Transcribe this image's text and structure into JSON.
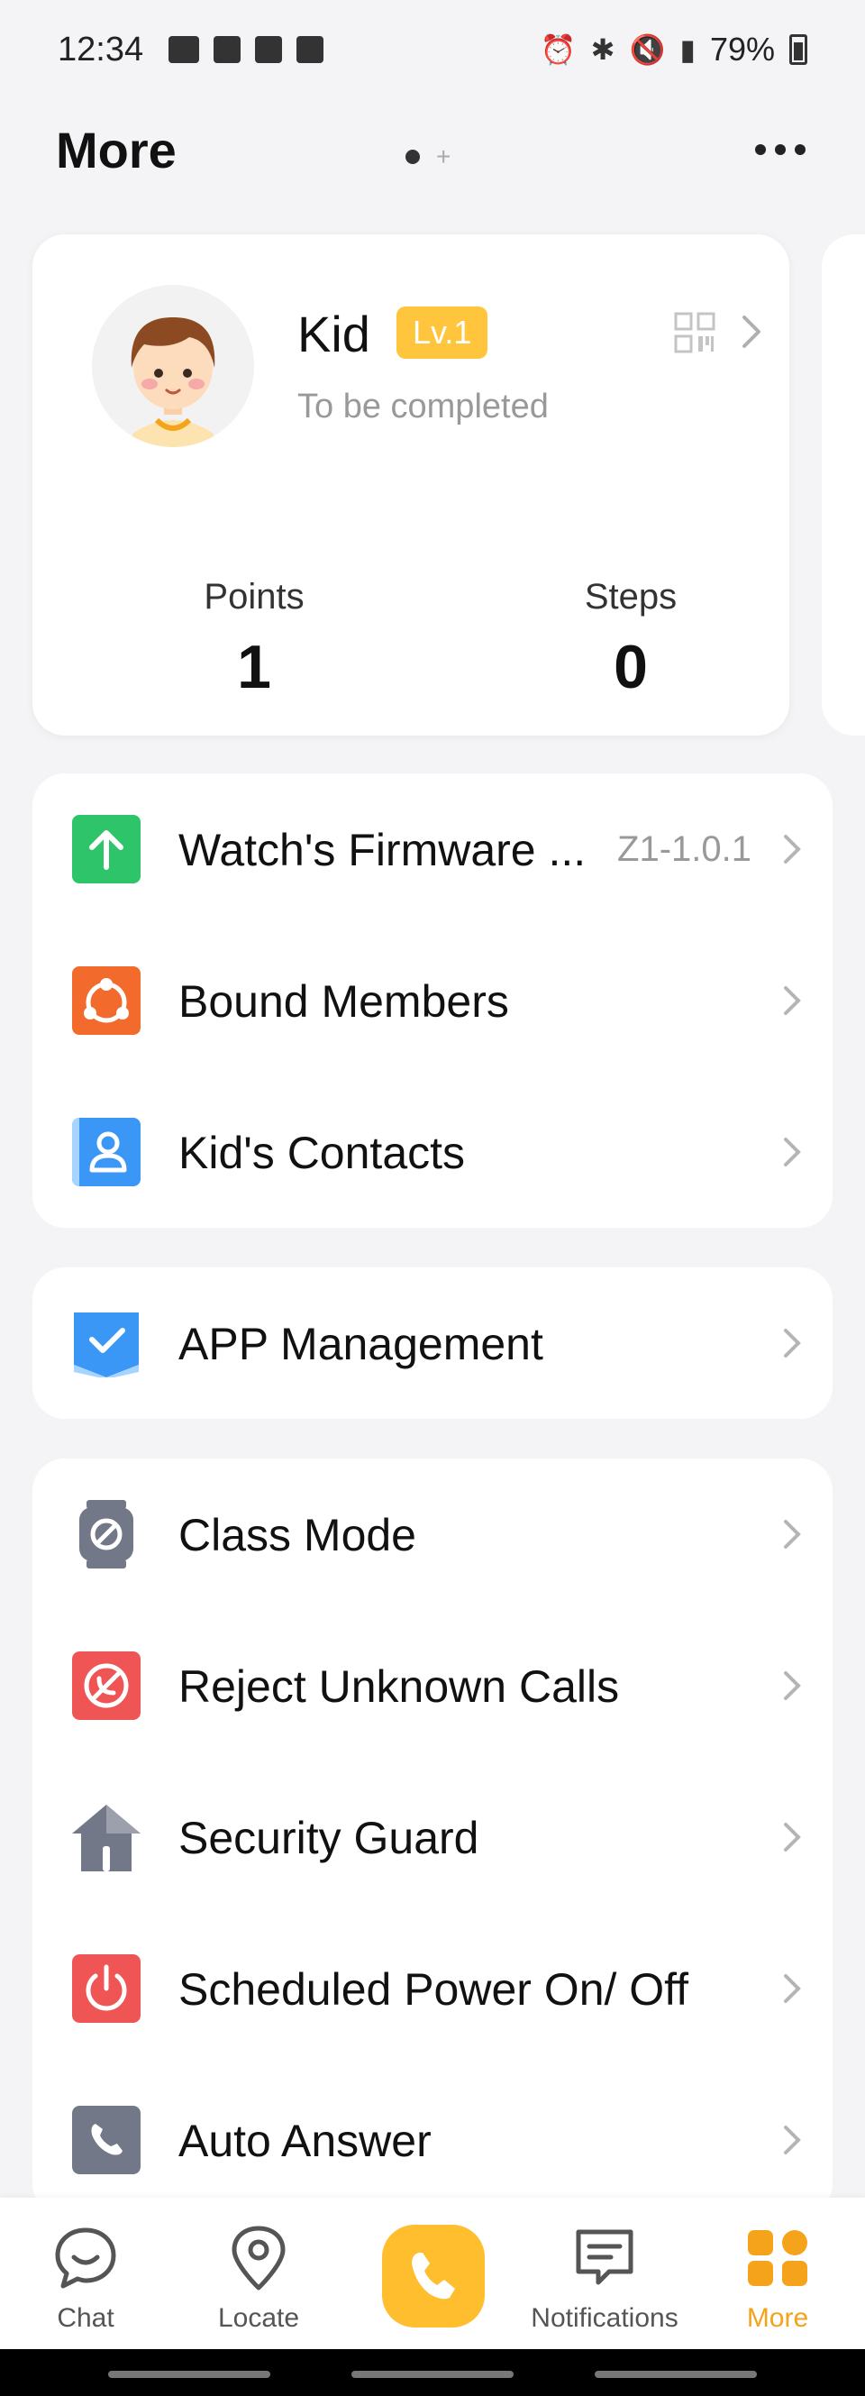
{
  "status_bar": {
    "time": "12:34",
    "battery": "79%"
  },
  "header": {
    "title": "More"
  },
  "profile": {
    "name": "Kid",
    "level": "Lv.1",
    "subtitle": "To be completed",
    "points_label": "Points",
    "points_value": "1",
    "steps_label": "Steps",
    "steps_value": "0"
  },
  "group1": {
    "items": [
      {
        "label": "Watch's Firmware ...",
        "value": "Z1-1.0.1",
        "icon": "firmware-upgrade-icon",
        "color": "#2ec46a"
      },
      {
        "label": "Bound Members",
        "icon": "bound-members-icon",
        "color": "#f26b2c"
      },
      {
        "label": "Kid's Contacts",
        "icon": "contacts-icon",
        "color": "#3b97f5"
      }
    ]
  },
  "group2": {
    "items": [
      {
        "label": "APP Management",
        "icon": "app-management-icon",
        "color": "#3b97f5"
      }
    ]
  },
  "group3": {
    "items": [
      {
        "label": "Class Mode",
        "icon": "class-mode-icon",
        "color": "#737889"
      },
      {
        "label": "Reject Unknown Calls",
        "icon": "reject-calls-icon",
        "color": "#f05555"
      },
      {
        "label": "Security Guard",
        "icon": "security-guard-icon",
        "color": "#737889"
      },
      {
        "label": "Scheduled Power On/ Off",
        "icon": "power-icon",
        "color": "#f05555"
      },
      {
        "label": "Auto Answer",
        "icon": "auto-answer-icon",
        "color": "#737889"
      }
    ]
  },
  "nav": {
    "chat": "Chat",
    "locate": "Locate",
    "notifications": "Notifications",
    "more": "More",
    "active_color": "#f5a31a",
    "call_color": "#ffbe2e"
  }
}
